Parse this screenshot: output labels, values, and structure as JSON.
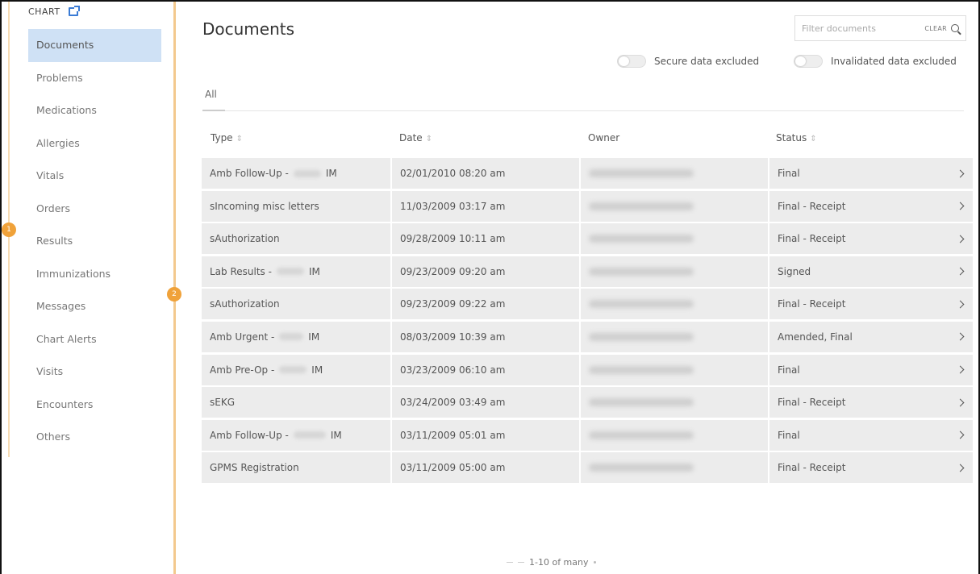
{
  "sidebar": {
    "header": "CHART",
    "items": [
      {
        "label": "Documents"
      },
      {
        "label": "Problems"
      },
      {
        "label": "Medications"
      },
      {
        "label": "Allergies"
      },
      {
        "label": "Vitals"
      },
      {
        "label": "Orders"
      },
      {
        "label": "Results"
      },
      {
        "label": "Immunizations"
      },
      {
        "label": "Messages"
      },
      {
        "label": "Chart Alerts"
      },
      {
        "label": "Visits"
      },
      {
        "label": "Encounters"
      },
      {
        "label": "Others"
      }
    ],
    "active_index": 0
  },
  "badges": {
    "one": "1",
    "two": "2"
  },
  "main": {
    "title": "Documents",
    "filter": {
      "placeholder": "Filter documents",
      "clear_label": "CLEAR"
    },
    "toggles": {
      "secure": "Secure data excluded",
      "invalidated": "Invalidated data excluded"
    },
    "tabs": [
      {
        "label": "All"
      }
    ],
    "columns": {
      "type": "Type",
      "date": "Date",
      "owner": "Owner",
      "status": "Status"
    },
    "sort_glyph": "⇕",
    "rows": [
      {
        "type_pre": "Amb Follow-Up -",
        "type_post": "IM",
        "date": "02/01/2010 08:20 am",
        "status": "Final"
      },
      {
        "type_pre": "sIncoming misc letters",
        "type_post": "",
        "date": "11/03/2009 03:17 am",
        "status": "Final - Receipt"
      },
      {
        "type_pre": "sAuthorization",
        "type_post": "",
        "date": "09/28/2009 10:11 am",
        "status": "Final - Receipt"
      },
      {
        "type_pre": "Lab Results -",
        "type_post": "IM",
        "date": "09/23/2009 09:20 am",
        "status": "Signed"
      },
      {
        "type_pre": "sAuthorization",
        "type_post": "",
        "date": "09/23/2009 09:22 am",
        "status": "Final - Receipt"
      },
      {
        "type_pre": "Amb Urgent -",
        "type_post": "IM",
        "date": "08/03/2009 10:39 am",
        "status": "Amended, Final"
      },
      {
        "type_pre": "Amb Pre-Op -",
        "type_post": "IM",
        "date": "03/23/2009 06:10 am",
        "status": "Final"
      },
      {
        "type_pre": "sEKG",
        "type_post": "",
        "date": "03/24/2009 03:49 am",
        "status": "Final - Receipt"
      },
      {
        "type_pre": "Amb Follow-Up -",
        "type_post": "IM",
        "date": "03/11/2009 05:01 am",
        "status": "Final"
      },
      {
        "type_pre": "GPMS Registration",
        "type_post": "",
        "date": "03/11/2009 05:00 am",
        "status": "Final - Receipt"
      }
    ],
    "pagination": "1-10 of many"
  }
}
